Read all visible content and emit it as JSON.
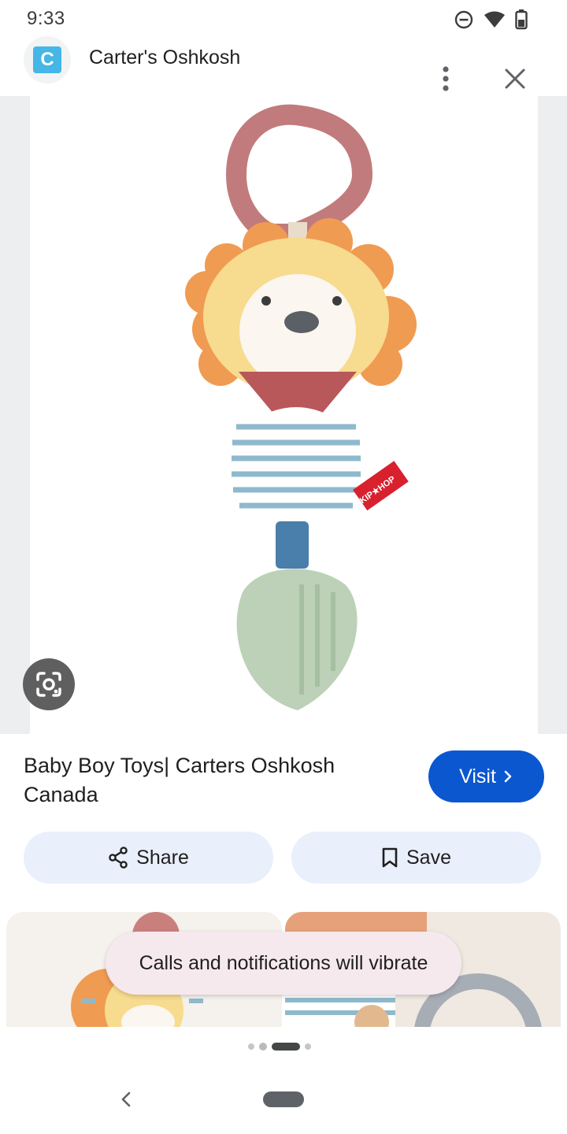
{
  "status": {
    "time": "9:33"
  },
  "header": {
    "site_name": "Carter's Oshkosh",
    "logo_letter": "C"
  },
  "product_image": {
    "brand_tag": "SKIP★HOP"
  },
  "result": {
    "title": "Baby Boy Toys| Carters Oshkosh Canada",
    "visit_label": "Visit"
  },
  "actions": {
    "share_label": "Share",
    "save_label": "Save"
  },
  "toast": {
    "message": "Calls and notifications will vibrate"
  },
  "colors": {
    "accent": "#0b57d0",
    "action_bg": "#e9effb",
    "toast_bg": "#f6e9ee",
    "logo_bg": "#45b6e6"
  },
  "icons": [
    "dnd-icon",
    "wifi-icon",
    "battery-icon",
    "more-vert-icon",
    "close-icon",
    "lens-icon",
    "chevron-right-icon",
    "share-icon",
    "bookmark-icon",
    "back-icon"
  ]
}
